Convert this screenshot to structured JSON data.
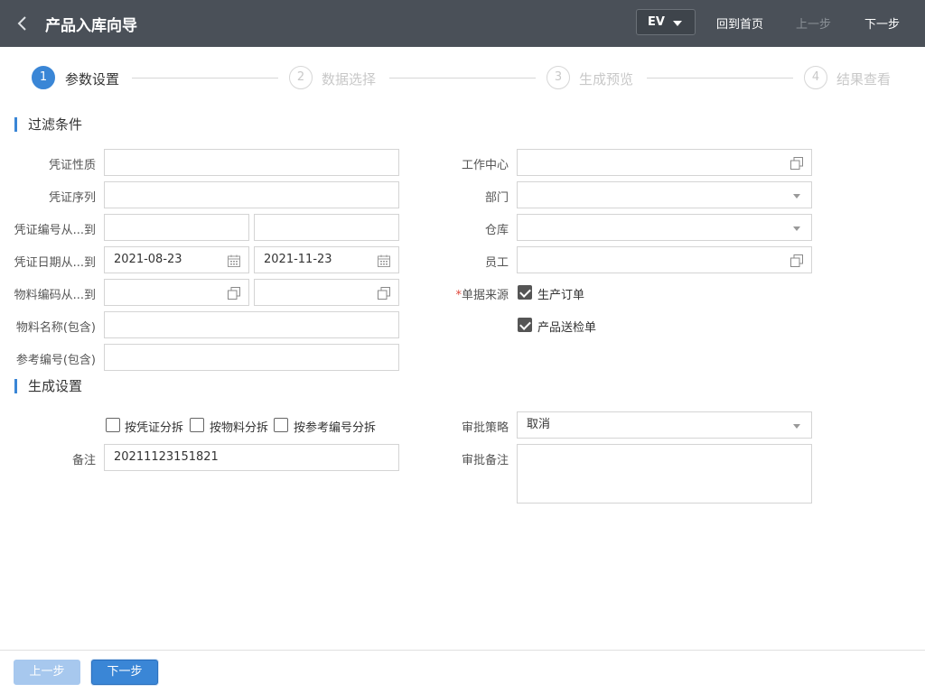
{
  "header": {
    "title": "产品入库向导",
    "lang": "EV",
    "home": "回到首页",
    "prev": "上一步",
    "next": "下一步"
  },
  "steps": [
    {
      "num": "1",
      "label": "参数设置"
    },
    {
      "num": "2",
      "label": "数据选择"
    },
    {
      "num": "3",
      "label": "生成预览"
    },
    {
      "num": "4",
      "label": "结果查看"
    }
  ],
  "filter": {
    "title": "过滤条件",
    "voucher_type": {
      "label": "凭证性质",
      "value": ""
    },
    "voucher_seq": {
      "label": "凭证序列",
      "value": ""
    },
    "voucher_no": {
      "label": "凭证编号从...到",
      "from": "",
      "to": ""
    },
    "voucher_date": {
      "label": "凭证日期从...到",
      "from": "2021-08-23",
      "to": "2021-11-23"
    },
    "material_code": {
      "label": "物料编码从...到",
      "from": "",
      "to": ""
    },
    "material_name": {
      "label": "物料名称(包含)",
      "value": ""
    },
    "ref_no": {
      "label": "参考编号(包含)",
      "value": ""
    },
    "work_center": {
      "label": "工作中心",
      "value": ""
    },
    "department": {
      "label": "部门",
      "value": ""
    },
    "warehouse": {
      "label": "仓库",
      "value": ""
    },
    "employee": {
      "label": "员工",
      "value": ""
    },
    "doc_source": {
      "required_mark": "*",
      "label": "单据来源",
      "options": [
        {
          "label": "生产订单",
          "checked": true
        },
        {
          "label": "产品送检单",
          "checked": true
        }
      ]
    }
  },
  "generate": {
    "title": "生成设置",
    "split_options": [
      {
        "label": "按凭证分拆",
        "checked": false
      },
      {
        "label": "按物料分拆",
        "checked": false
      },
      {
        "label": "按参考编号分拆",
        "checked": false
      }
    ],
    "remark": {
      "label": "备注",
      "value": "20211123151821"
    },
    "approval_policy": {
      "label": "审批策略",
      "value": "取消"
    },
    "approval_remark": {
      "label": "审批备注",
      "value": ""
    }
  },
  "footer": {
    "prev": "上一步",
    "next": "下一步"
  },
  "colors": {
    "header_bg": "#4a5058",
    "accent": "#3a86d6"
  }
}
